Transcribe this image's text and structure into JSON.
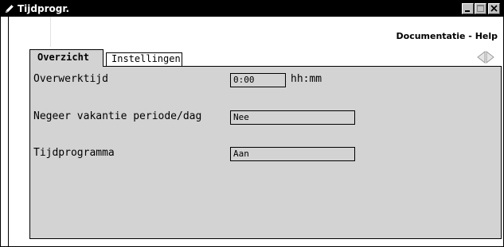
{
  "window": {
    "title": "Tijdprogr.",
    "help_link": "Documentatie - Help"
  },
  "tabs": [
    {
      "label": "Overzicht",
      "active": true
    },
    {
      "label": "Instellingen",
      "active": false
    }
  ],
  "form": {
    "overwerktijd": {
      "label": "Overwerktijd",
      "value": "0:00",
      "unit": "hh:mm"
    },
    "negeer_vakantie": {
      "label": "Negeer vakantie periode/dag",
      "value": "Nee"
    },
    "tijdprogramma": {
      "label": "Tijdprogramma",
      "value": "Aan"
    }
  },
  "icons": {
    "app": "pencil-icon",
    "minimize": "minimize-icon",
    "maximize": "maximize-icon",
    "close": "close-icon",
    "prev": "arrow-left-icon",
    "next": "arrow-right-icon"
  },
  "colors": {
    "titlebar": "#000000",
    "panel": "#d3d3d3",
    "background": "#ffffff"
  }
}
